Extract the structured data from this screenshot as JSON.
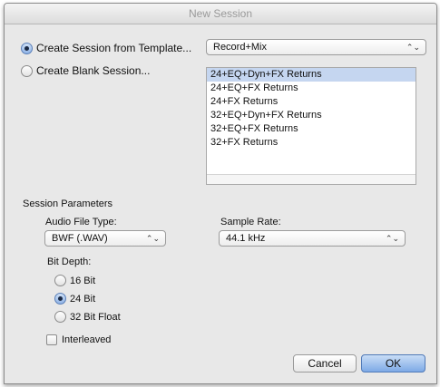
{
  "window": {
    "title": "New Session"
  },
  "options": {
    "from_template_label": "Create Session from Template...",
    "blank_label": "Create Blank Session..."
  },
  "template_category": {
    "value": "Record+Mix",
    "arrows": "⌃⌄"
  },
  "templates": [
    "24+EQ+Dyn+FX Returns",
    "24+EQ+FX Returns",
    "24+FX Returns",
    "32+EQ+Dyn+FX Returns",
    "32+EQ+FX Returns",
    "32+FX Returns"
  ],
  "params": {
    "section_title": "Session Parameters",
    "audio_file_type_label": "Audio File Type:",
    "audio_file_type_value": "BWF (.WAV)",
    "sample_rate_label": "Sample Rate:",
    "sample_rate_value": "44.1 kHz",
    "bit_depth_label": "Bit Depth:",
    "bit_16": "16 Bit",
    "bit_24": "24 Bit",
    "bit_32": "32 Bit Float",
    "interleaved_label": "Interleaved"
  },
  "buttons": {
    "cancel": "Cancel",
    "ok": "OK"
  }
}
